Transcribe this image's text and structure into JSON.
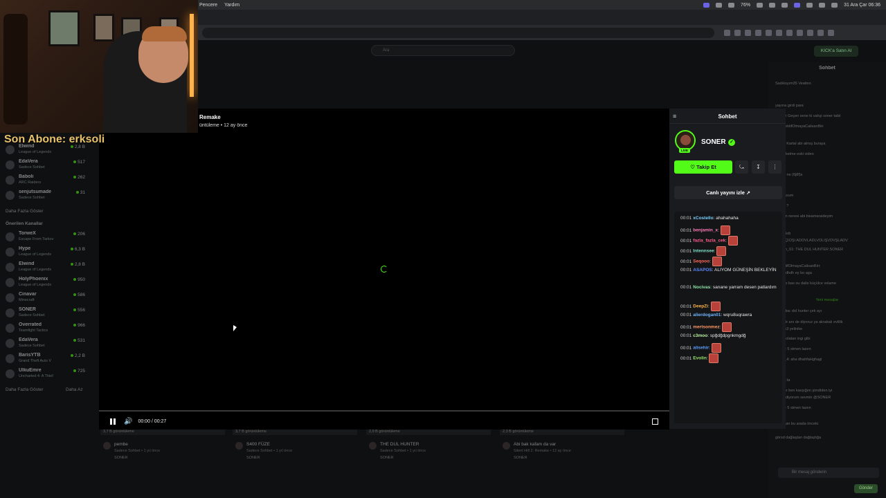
{
  "menubar": {
    "items": [
      "Pencere",
      "Yardım"
    ],
    "battery": "76%",
    "date_time": "31 Ara Çar 06:36"
  },
  "site": {
    "search_placeholder": "Ara",
    "kick_button": "KICK'a Satın Al"
  },
  "overlay": {
    "subscriber_text": "Son Abone: erksoli"
  },
  "video": {
    "title": "Remake",
    "meta": "üntüleme • 12 ay önce",
    "time": "00:00 / 00:27",
    "progress": 0
  },
  "sidebar": {
    "channels": [
      {
        "name": "Elwind",
        "category": "League of Legends",
        "viewers": "2,8 B"
      },
      {
        "name": "EdaVera",
        "category": "Sadece Sohbet",
        "viewers": "517"
      },
      {
        "name": "Baboli",
        "category": "ARC Raiders",
        "viewers": "262"
      },
      {
        "name": "senjutsumade",
        "category": "Sadece Sohbet",
        "viewers": "31"
      }
    ],
    "more_label": "Daha Fazla Göster",
    "recommended_heading": "Önerilen Kanallar",
    "recommended": [
      {
        "name": "TorweX",
        "category": "Escape From Tarkov",
        "viewers": "206"
      },
      {
        "name": "Hype",
        "category": "League of Legends",
        "viewers": "6,3 B"
      },
      {
        "name": "Elwind",
        "category": "League of Legends",
        "viewers": "2,8 B"
      },
      {
        "name": "HolyPhoenix",
        "category": "League of Legends",
        "viewers": "950"
      },
      {
        "name": "Cinavar",
        "category": "Minecraft",
        "viewers": "586"
      },
      {
        "name": "SONER",
        "category": "Sadece Sohbet",
        "viewers": "556"
      },
      {
        "name": "Overrated",
        "category": "Teamfight Tactics",
        "viewers": "966"
      },
      {
        "name": "EdaVera",
        "category": "Sadece Sohbet",
        "viewers": "531"
      },
      {
        "name": "BarisYTB",
        "category": "Grand Theft Auto V",
        "viewers": "2,2 B"
      },
      {
        "name": "UlkuEmre",
        "category": "Uncharted 4: A Thief",
        "viewers": "725"
      }
    ],
    "more_label_2": "Daha Fazla Göster",
    "less_label": "Daha Az"
  },
  "related": [
    {
      "views": "3,7 B görüntüleme",
      "title": "pembe",
      "sub": "Sadece Sohbet • 1 yıl önce",
      "channel": "SONER"
    },
    {
      "views": "3,7 B görüntüleme",
      "title": "S400 FÜZE",
      "sub": "Sadece Sohbet • 1 yıl önce",
      "channel": "SONER"
    },
    {
      "views": "2,9 B görüntüleme",
      "title": "THE DUL HUNTER",
      "sub": "Sadece Sohbet • 1 yıl önce",
      "channel": "SONER"
    },
    {
      "views": "2,3 B görüntüleme",
      "title": "Abi bak kafam da var",
      "sub": "Silent Hill 2: Remake • 12 ay önce",
      "channel": "SONER"
    }
  ],
  "chat": {
    "header": "Sohbet",
    "channel_name": "SONER",
    "live_badge": "LIVE",
    "follow_label": "Takip Et",
    "watch_live_label": "Canlı yayını izle",
    "messages": [
      {
        "time": "00:01",
        "user": "xCostello",
        "color": "#7ad0ff",
        "text": "ahahahaha",
        "emote": false
      },
      {
        "time": "00:01",
        "user": "benjamin_x",
        "color": "#ff7ab8",
        "text": "",
        "emote": true
      },
      {
        "time": "00:01",
        "user": "fazla_fazla_cek",
        "color": "#ff5f8f",
        "text": "",
        "emote": true
      },
      {
        "time": "00:01",
        "user": "Intennsee",
        "color": "#7ee0c8",
        "text": "",
        "emote": true
      },
      {
        "time": "00:01",
        "user": "Seqooo",
        "color": "#ff6a5a",
        "text": "",
        "emote": true
      },
      {
        "time": "00:01",
        "user": "ASAPOS",
        "color": "#5b8bff",
        "text": "ALIYOM GÜNEŞİN BEKLEYİN",
        "emote": false
      },
      {
        "time": "00:01",
        "user": "Nocivas",
        "color": "#8ee6a8",
        "text": "sanane yarram desen patlardım",
        "emote": false
      },
      {
        "time": "00:01",
        "user": "DeepZi",
        "color": "#ffb347",
        "text": "",
        "emote": true
      },
      {
        "time": "00:01",
        "user": "alierdogan01",
        "color": "#6fb6ff",
        "text": "wqru8uqrawra",
        "emote": false
      },
      {
        "time": "00:01",
        "user": "mertsonmez",
        "color": "#ff9a6a",
        "text": "",
        "emote": true
      },
      {
        "time": "00:01",
        "user": "c3moo",
        "color": "#b9f5a0",
        "text": "spğdğdpgnkmgdğ",
        "emote": false
      },
      {
        "time": "00:01",
        "user": "alisehir",
        "color": "#5aa0ff",
        "text": "",
        "emote": true
      },
      {
        "time": "00:01",
        "user": "Evolin",
        "color": "#9ae36a",
        "text": "",
        "emote": true
      }
    ]
  },
  "bg_chat": {
    "header": "Sohbet",
    "lines": [
      "Sadıksyım35  Veatino",
      "yayına girdi para",
      "aracaz Geçen sene ki vahşi soner tabii",
      "@ObjektifOlmayaCalisanBiri",
      "Mayıs Kartal abi almış buraya",
      "gül bukelme eski video",
      "cigara",
      "sigara ne (6j8f)s",
      "minnissum",
      "minoş ?",
      "İzmir in neresi abi bisamaraideyim",
      "SeezBob",
      "AKVLÇIOŞİ ADOVLADLVÖLİŞVDVŞLADV",
      "r_Fatih_61: THE DUL HUNTER SONER",
      "ObjektifOlmayaCalisanBiri:",
      "dhdhkdhdh ey bo aga",
      "minsyo bas ou dalio küçülce velame",
      "Yeni mesajlar",
      "ustigaba: dol hunter çek ayı",
      "mihabir anı de diyoruz ya akrabalı evlilik",
      "ünce k3 yelinike",
      "tedn bolatan ingi gibi",
      "lesabi: 5 stmen lazen",
      "esabi_4: aha dhahfaHghagi",
      "ürbabi:ta",
      "Soneer ben kavşığım şimdiden iyi",
      "gelen diyorum sevmin @SONER",
      "lesabi: 5 stmen lazen",
      "ahhh tan bu arada önceki",
      "görsd dağlaştan dağlaştığa"
    ],
    "new_messages_label": "Yeni mesajlar",
    "input_placeholder": "Bir mesaj gönderin",
    "send_label": "Gönder"
  }
}
